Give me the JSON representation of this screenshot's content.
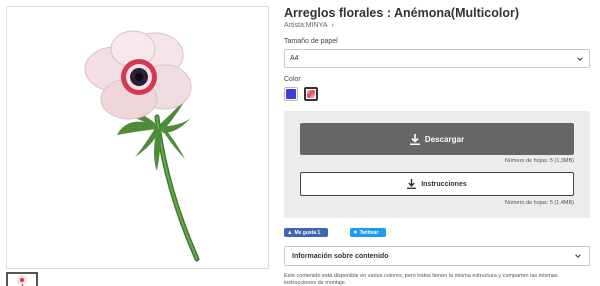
{
  "product": {
    "title": "Arreglos florales : Anémona(Multicolor)",
    "artist": "Artista:MINYA",
    "artist_chevron": "›"
  },
  "paper": {
    "label": "Tamaño de papel",
    "selected": "A4"
  },
  "color": {
    "label": "Color",
    "options": [
      "blue-swatch",
      "multicolor-swatch"
    ],
    "colors": {
      "blue": "#3d3fcf",
      "multicolor": "#e04a5a"
    }
  },
  "download": {
    "label": "Descargar",
    "note": "Número de hojas: 5 (1.3MB)"
  },
  "instructions": {
    "label": "Instrucciones",
    "note": "Número de hojas: 5 (1.4MB)"
  },
  "social": {
    "facebook": "Me gusta 1",
    "twitter": "Twittear"
  },
  "info": {
    "label": "Información sobre contenido",
    "description": "Este contenido está disponible en varios colores, pero todos tienen la misma estructura y comparten las mismas instrucciones de montaje."
  }
}
